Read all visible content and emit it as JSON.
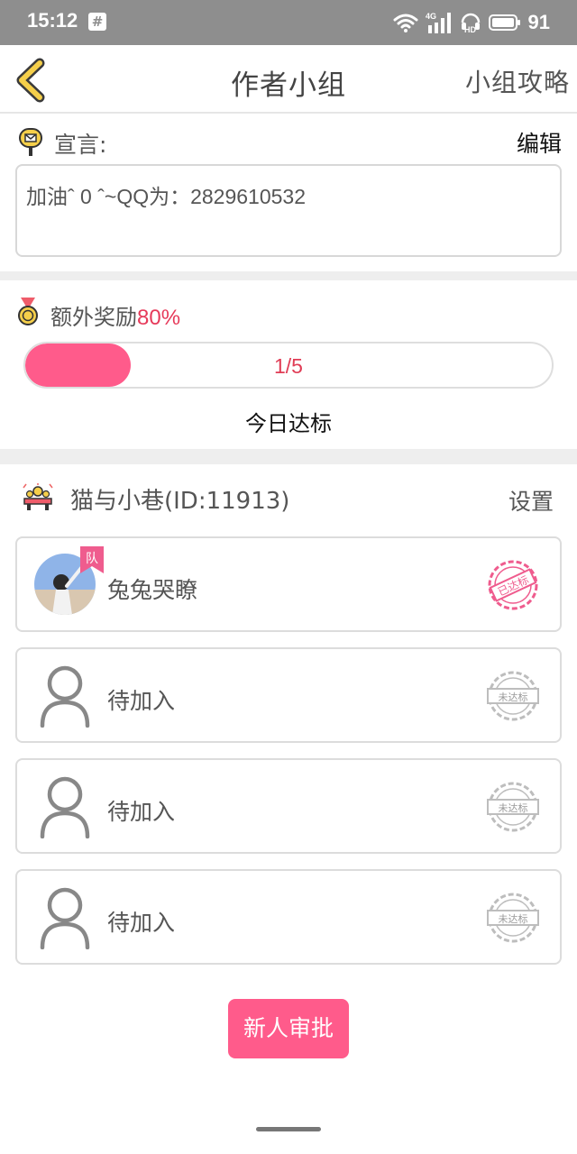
{
  "status_bar": {
    "time": "15:12",
    "notification_glyph": "#",
    "network_label": "4G",
    "hd_label": "HD",
    "battery": "91",
    "icons": [
      "wifi-icon",
      "signal-icon",
      "hd-icon",
      "battery-icon"
    ]
  },
  "header": {
    "title": "作者小组",
    "guide_label": "小组攻略",
    "back_icon": "chevron-left-icon"
  },
  "manifesto": {
    "label": "宣言:",
    "edit_label": "编辑",
    "text": "加油ˆ 0 ˆ~QQ为：2829610532"
  },
  "bonus": {
    "label": "额外奖励",
    "percent": "80%",
    "progress_text": "1/5",
    "progress_value": 0.2,
    "today_label": "今日达标"
  },
  "group": {
    "name": "猫与小巷(ID:11913)",
    "settings_label": "设置",
    "members": [
      {
        "name": "兔兔哭瞭",
        "badge": "队",
        "status": "已达标",
        "status_color": "#ef5c8e"
      },
      {
        "name": "待加入",
        "status": "未达标",
        "status_color": "#bdbdbd"
      },
      {
        "name": "待加入",
        "status": "未达标",
        "status_color": "#bdbdbd"
      },
      {
        "name": "待加入",
        "status": "未达标",
        "status_color": "#bdbdbd"
      }
    ]
  },
  "approve_button": "新人审批",
  "colors": {
    "accent": "#ff5b8b",
    "highlight_text": "#e63a5a",
    "back_arrow": "#f2c94c",
    "status_bar": "#8e8e8e"
  }
}
